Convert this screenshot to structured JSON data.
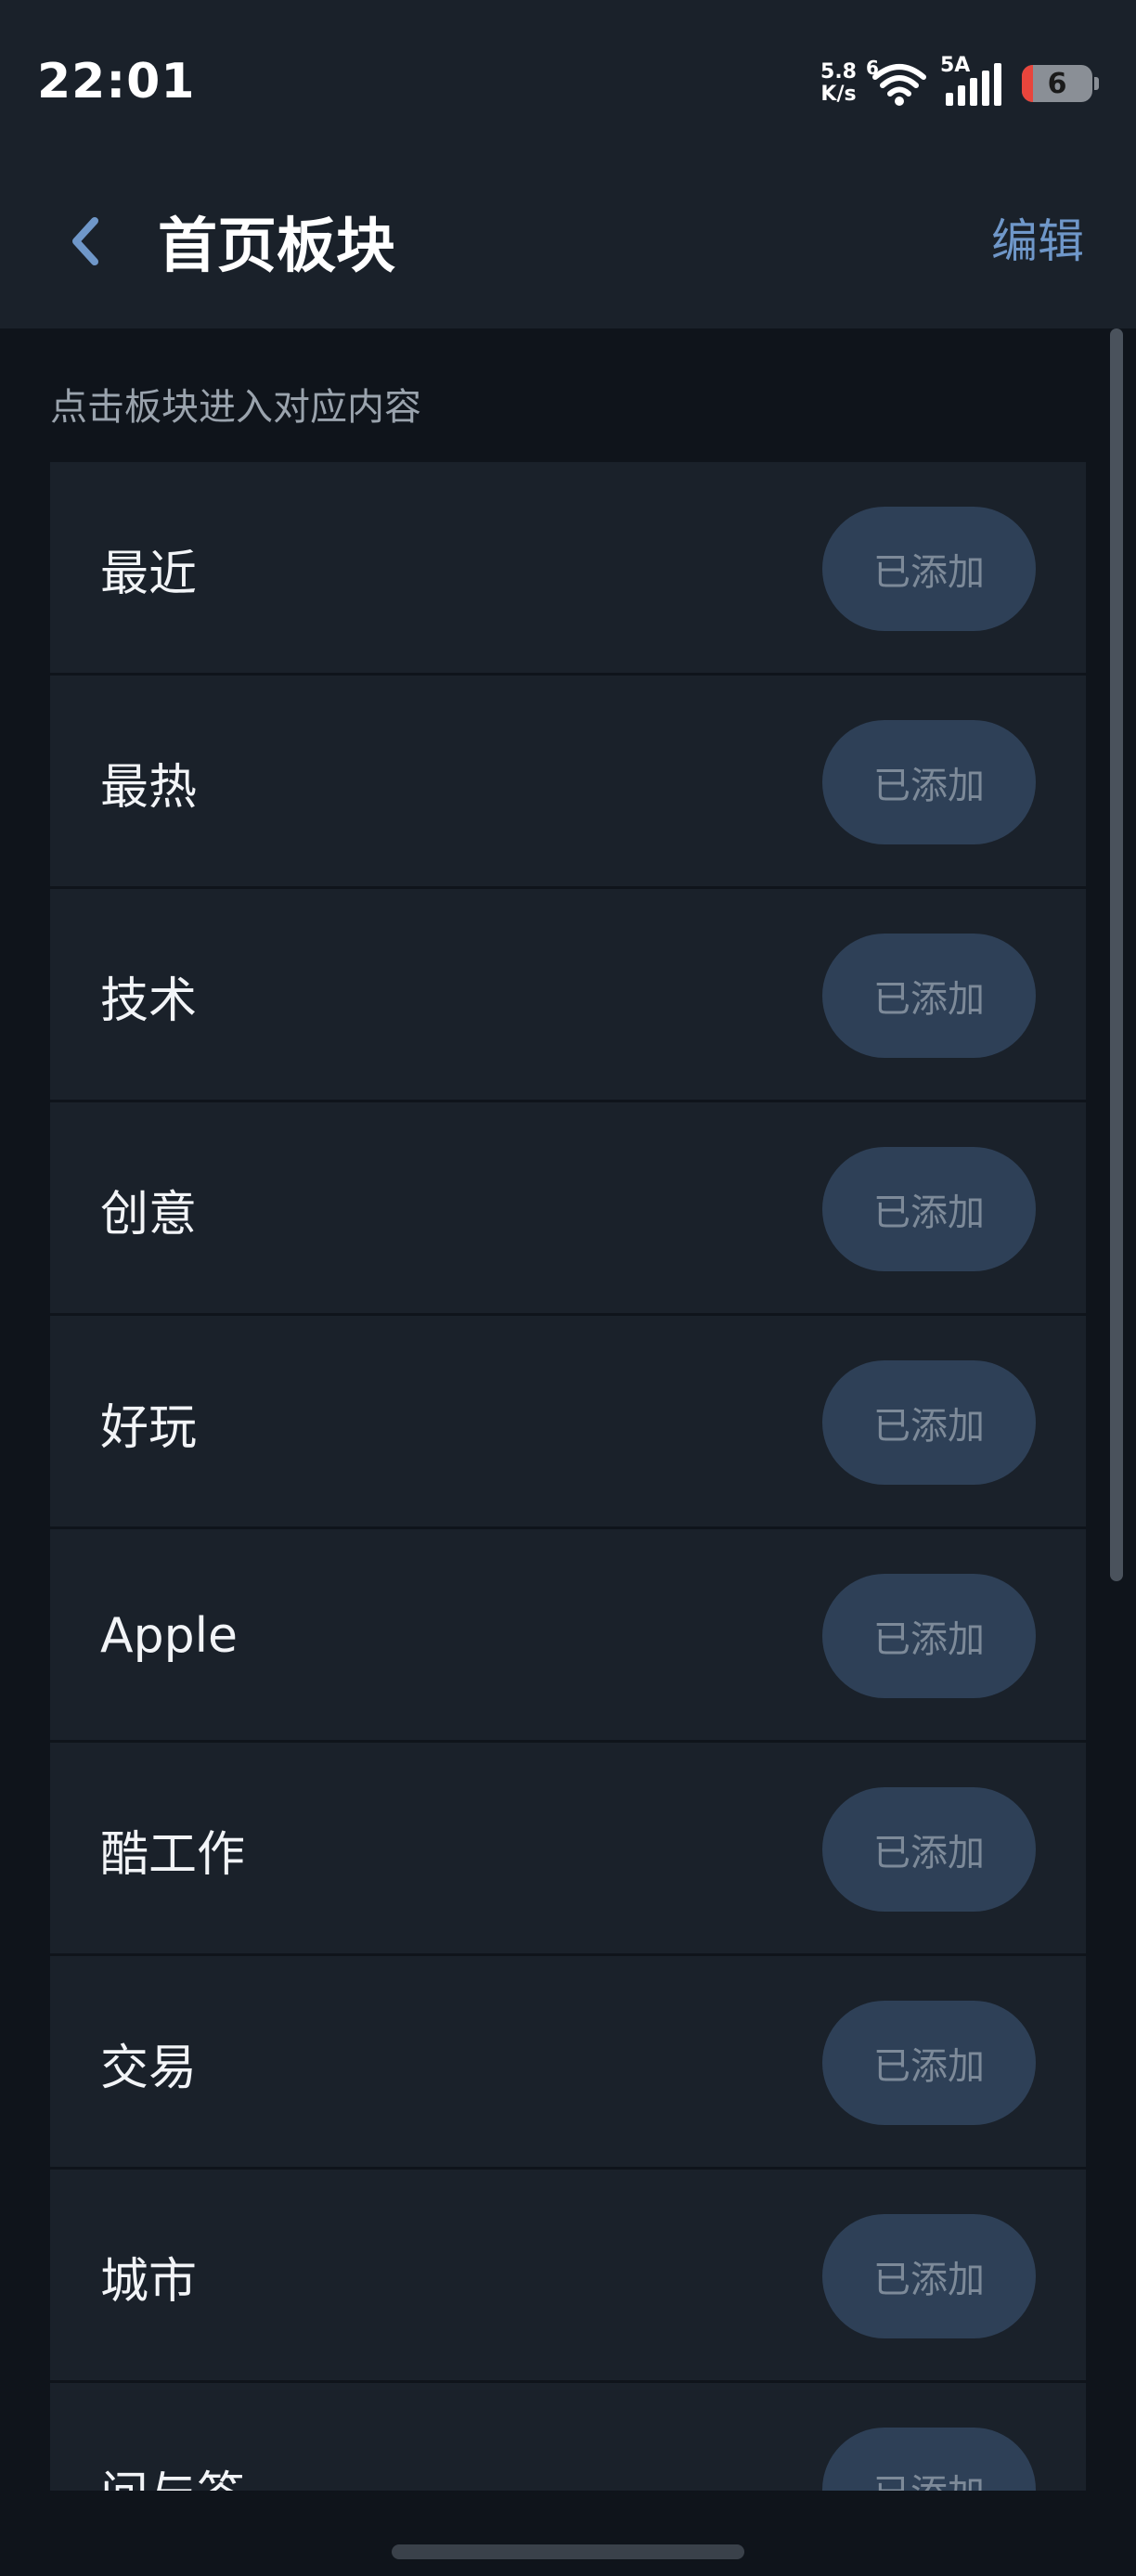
{
  "status_bar": {
    "time": "22:01",
    "net_speed_value": "5.8",
    "net_speed_unit": "K/s",
    "wifi_label": "6",
    "signal_label": "5A",
    "battery_level": "6"
  },
  "header": {
    "title": "首页板块",
    "edit_label": "编辑"
  },
  "hint": "点击板块进入对应内容",
  "sections": [
    {
      "label": "最近",
      "status": "已添加"
    },
    {
      "label": "最热",
      "status": "已添加"
    },
    {
      "label": "技术",
      "status": "已添加"
    },
    {
      "label": "创意",
      "status": "已添加"
    },
    {
      "label": "好玩",
      "status": "已添加"
    },
    {
      "label": "Apple",
      "status": "已添加"
    },
    {
      "label": "酷工作",
      "status": "已添加"
    },
    {
      "label": "交易",
      "status": "已添加"
    },
    {
      "label": "城市",
      "status": "已添加"
    },
    {
      "label": "问与答",
      "status": "已添加"
    }
  ],
  "colors": {
    "background": "#0f141b",
    "surface": "#1a212a",
    "accent": "#6f97c9",
    "button_bg": "#2e4057",
    "button_text": "#7d8a99"
  }
}
